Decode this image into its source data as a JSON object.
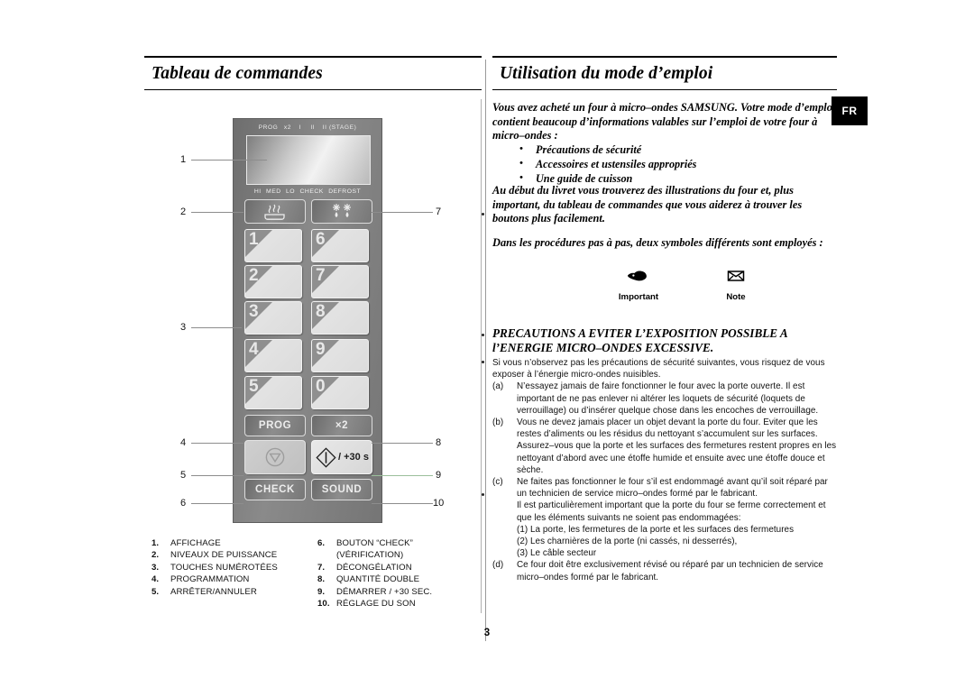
{
  "page": {
    "number": "3",
    "language_tab": "FR"
  },
  "left_column": {
    "heading": "Tableau de commandes",
    "control_panel": {
      "display_top_labels": [
        "PROG",
        "x2",
        "I",
        "II",
        "II (STAGE)"
      ],
      "display_bottom_labels": [
        "HI",
        "MED",
        "LO",
        "CHECK",
        "DEFROST"
      ],
      "power_button": "power-level-icon",
      "defrost_button": "defrost-icon",
      "number_keys": [
        "1",
        "2",
        "3",
        "4",
        "5",
        "6",
        "7",
        "8",
        "9",
        "0"
      ],
      "prog_button": "PROG",
      "x2_button": "×2",
      "stop_button": "stop-icon",
      "start_button_icon": "start-diamond-icon",
      "start_button_label": "/ +30 s",
      "check_button": "CHECK",
      "sound_button": "SOUND"
    },
    "callouts_left": [
      "1",
      "2",
      "3",
      "4",
      "5",
      "6"
    ],
    "callouts_right": [
      "7",
      "8",
      "9",
      "10"
    ],
    "legend_left": [
      {
        "n": "1.",
        "text": "AFFICHAGE"
      },
      {
        "n": "2.",
        "text": "NIVEAUX DE PUISSANCE"
      },
      {
        "n": "3.",
        "text": "TOUCHES NUMÉROTÉES"
      },
      {
        "n": "4.",
        "text": "PROGRAMMATION"
      },
      {
        "n": "5.",
        "text": "ARRÊTER/ANNULER"
      }
    ],
    "legend_right": [
      {
        "n": "6.",
        "text": "BOUTON “CHECK”",
        "sub": "(VÉRIFICATION)"
      },
      {
        "n": "7.",
        "text": "DÉCONGÉLATION"
      },
      {
        "n": "8.",
        "text": "QUANTITÉ DOUBLE"
      },
      {
        "n": "9.",
        "text": "DÉMARRER / +30 SEC."
      },
      {
        "n": "10.",
        "text": "RÉGLAGE DU SON"
      }
    ]
  },
  "right_column": {
    "heading": "Utilisation du mode d’emploi",
    "intro": "Vous avez acheté un four à micro–ondes SAMSUNG. Votre mode d’emploi contient beaucoup d’informations valables sur l’emploi de votre four à micro–ondes :",
    "bullets": [
      "Précautions de sécurité",
      "Accessoires et ustensiles appropriés",
      "Une guide de cuisson"
    ],
    "para2": "Au début du livret vous trouverez des illustrations du four et, plus important, du tableau de commandes que vous aiderez à trouver les boutons plus facilement.",
    "para3": "Dans les procédures pas à pas, deux symboles différents sont employés :",
    "symbols": [
      {
        "icon": "pointing-hand-icon",
        "label": "Important"
      },
      {
        "icon": "envelope-icon",
        "label": "Note"
      }
    ],
    "warning_heading_line1": "PRECAUTIONS A EVITER L’EXPOSITION POSSIBLE A",
    "warning_heading_line2": "l’ENERGIE MICRO–ONDES EXCESSIVE.",
    "warning_intro": "Si vous n’observez pas les précautions de sécurité suivantes, vous risquez de vous exposer à l’énergie micro-ondes nuisibles.",
    "items": [
      {
        "label": "(a)",
        "text": "N’essayez jamais de faire fonctionner le four avec la porte ouverte. Il est important de ne pas enlever ni altérer les loquets de sécurité (loquets de verrouillage) ou d’insérer quelque chose dans les encoches de verrouillage."
      },
      {
        "label": "(b)",
        "text": "Vous ne devez jamais placer un objet devant la porte du four. Eviter que les restes d’aliments ou les résidus du nettoyant s’accumulent sur les surfaces. Assurez–vous que la porte et les surfaces des fermetures restent propres en les nettoyant d’abord avec une étoffe humide et ensuite avec une étoffe douce et sèche."
      },
      {
        "label": "(c)",
        "text": "Ne faites pas fonctionner le four s’il est endommagé avant qu’il soit réparé par un technicien de service micro–ondes formé par le fabricant."
      }
    ],
    "item_c_note": "Il est particulièrement important que la porte du four se ferme correctement et que les éléments suivants ne soient pas endommagées:",
    "item_c_sublist": [
      "(1) La porte, les fermetures de la porte et les surfaces des fermetures",
      "(2) Les charnières de la porte (ni cassés, ni desserrés),",
      "(3) Le câble secteur"
    ],
    "item_d": {
      "label": "(d)",
      "text": "Ce four doit être exclusivement révisé ou réparé par un technicien de service micro–ondes formé par le fabricant."
    }
  }
}
